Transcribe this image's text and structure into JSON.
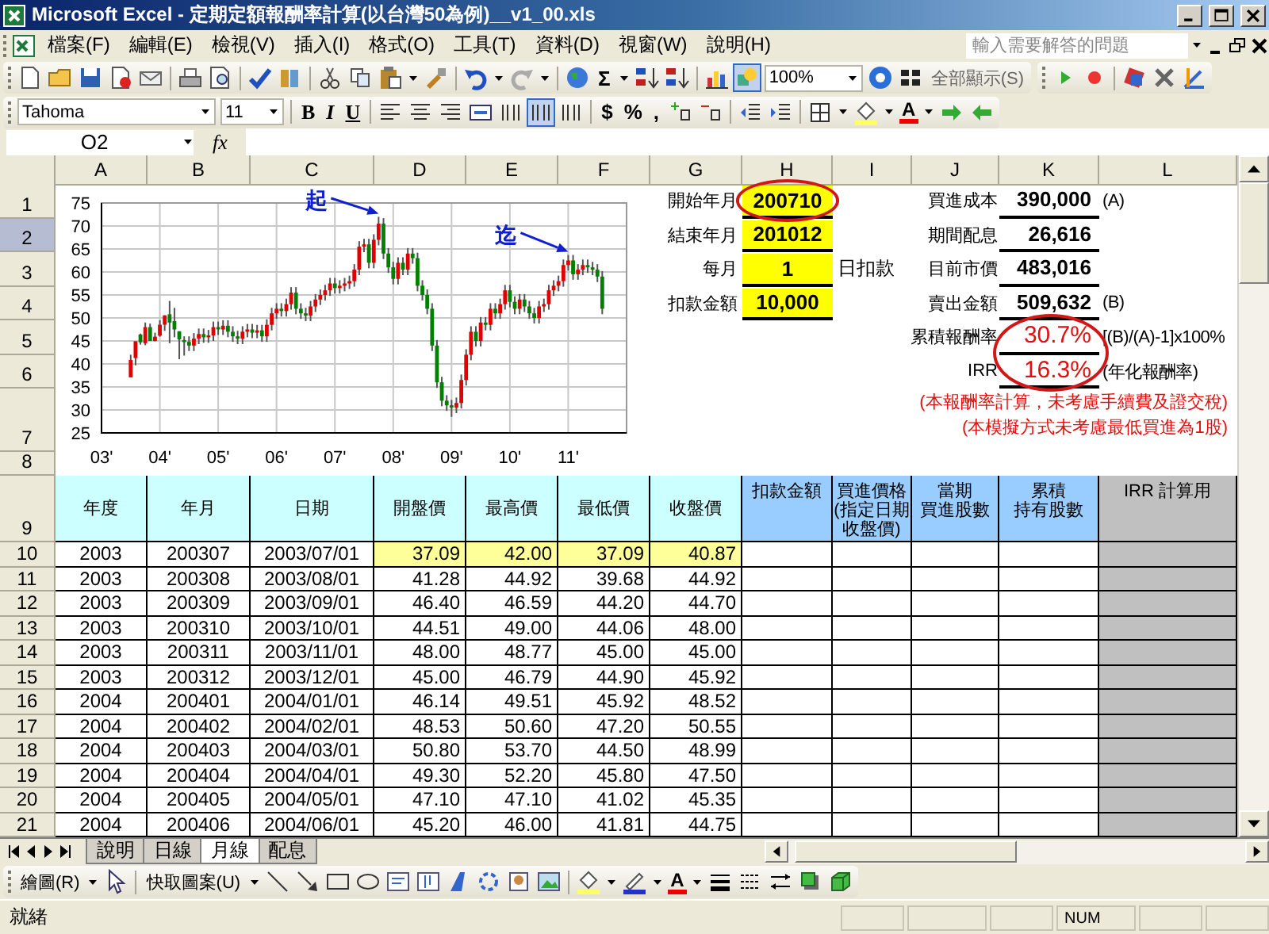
{
  "window": {
    "title": "Microsoft Excel - 定期定額報酬率計算(以台灣50為例)__v1_00.xls"
  },
  "menu": [
    "檔案(F)",
    "編輯(E)",
    "檢視(V)",
    "插入(I)",
    "格式(O)",
    "工具(T)",
    "資料(D)",
    "視窗(W)",
    "說明(H)"
  ],
  "help_box": {
    "placeholder": "輸入需要解答的問題"
  },
  "standard_toolbar": {
    "sum": "Σ",
    "drawing_button": {
      "selected": true
    },
    "zoom": "100%",
    "show_all": "全部顯示(S)"
  },
  "formatting_toolbar": {
    "font": "Tahoma",
    "size": "11",
    "styles": [
      "B",
      "I",
      "U"
    ],
    "layout_buttons": [
      {
        "selected": false
      },
      {
        "selected": true
      },
      {
        "selected": false
      }
    ],
    "currency": "$",
    "percent": "%",
    "comma": ",",
    "font_color": "A"
  },
  "formula_bar": {
    "name_box": "O2",
    "fx": "fx"
  },
  "columns": [
    "A",
    "B",
    "C",
    "D",
    "E",
    "F",
    "G",
    "H",
    "I",
    "J",
    "K",
    "L"
  ],
  "row_numbers": [
    {
      "label": "1",
      "selected": false
    },
    {
      "label": "2",
      "selected": true
    },
    {
      "label": "3",
      "selected": false
    },
    {
      "label": "4",
      "selected": false
    },
    {
      "label": "5",
      "selected": false
    },
    {
      "label": "6",
      "selected": false
    },
    {
      "label": "7",
      "selected": false
    },
    {
      "label": "8",
      "selected": false
    },
    {
      "label": "9",
      "selected": false
    },
    {
      "label": "10",
      "selected": false
    },
    {
      "label": "11",
      "selected": false
    },
    {
      "label": "12",
      "selected": false
    },
    {
      "label": "13",
      "selected": false
    },
    {
      "label": "14",
      "selected": false
    },
    {
      "label": "15",
      "selected": false
    },
    {
      "label": "16",
      "selected": false
    },
    {
      "label": "17",
      "selected": false
    },
    {
      "label": "18",
      "selected": false
    },
    {
      "label": "19",
      "selected": false
    },
    {
      "label": "20",
      "selected": false
    },
    {
      "label": "21",
      "selected": false
    }
  ],
  "chart": {
    "chart_data": {
      "type": "candlestick",
      "grid": true,
      "xlim": [
        3,
        12
      ],
      "ylim": [
        25,
        75
      ],
      "yticks": [
        25,
        30,
        35,
        40,
        45,
        50,
        55,
        60,
        65,
        70,
        75
      ],
      "xticks": [
        {
          "value": 3,
          "label": "03'"
        },
        {
          "value": 4,
          "label": "04'"
        },
        {
          "value": 5,
          "label": "05'"
        },
        {
          "value": 6,
          "label": "06'"
        },
        {
          "value": 7,
          "label": "07'"
        },
        {
          "value": 8,
          "label": "08'"
        },
        {
          "value": 9,
          "label": "09'"
        },
        {
          "value": 10,
          "label": "10'"
        },
        {
          "value": 11,
          "label": "11'"
        }
      ],
      "x": [
        3.5,
        3.583,
        3.667,
        3.75,
        3.833,
        3.917,
        4.0,
        4.083,
        4.167,
        4.25,
        4.333,
        4.417,
        4.5,
        4.583,
        4.667,
        4.75,
        4.833,
        4.917,
        5.0,
        5.083,
        5.167,
        5.25,
        5.333,
        5.417,
        5.5,
        5.583,
        5.667,
        5.75,
        5.833,
        5.917,
        6.0,
        6.083,
        6.167,
        6.25,
        6.333,
        6.417,
        6.5,
        6.583,
        6.667,
        6.75,
        6.833,
        6.917,
        7.0,
        7.083,
        7.167,
        7.25,
        7.333,
        7.417,
        7.5,
        7.583,
        7.667,
        7.75,
        7.833,
        7.917,
        8.0,
        8.083,
        8.167,
        8.25,
        8.333,
        8.417,
        8.5,
        8.583,
        8.667,
        8.75,
        8.833,
        8.917,
        9.0,
        9.083,
        9.167,
        9.25,
        9.333,
        9.417,
        9.5,
        9.583,
        9.667,
        9.75,
        9.833,
        9.917,
        10.0,
        10.083,
        10.167,
        10.25,
        10.333,
        10.417,
        10.5,
        10.583,
        10.667,
        10.75,
        10.833,
        10.917,
        11.0,
        11.083,
        11.167,
        11.25,
        11.333,
        11.417,
        11.5,
        11.583
      ],
      "ohlc": [
        [
          37.09,
          42.0,
          37.09,
          40.87
        ],
        [
          41.28,
          44.92,
          39.68,
          44.92
        ],
        [
          46.4,
          46.59,
          44.2,
          44.7
        ],
        [
          44.51,
          49.0,
          44.06,
          48.0
        ],
        [
          48.0,
          48.77,
          45.0,
          45.0
        ],
        [
          45.0,
          46.79,
          44.9,
          45.92
        ],
        [
          46.14,
          49.51,
          45.92,
          48.52
        ],
        [
          48.53,
          50.6,
          47.2,
          50.55
        ],
        [
          50.8,
          53.7,
          44.5,
          48.99
        ],
        [
          49.3,
          52.2,
          45.8,
          47.5
        ],
        [
          47.1,
          47.1,
          41.02,
          45.35
        ],
        [
          45.2,
          46.0,
          41.81,
          44.75
        ],
        [
          44.8,
          46.0,
          42.8,
          44.0
        ],
        [
          44.0,
          46.7,
          42.8,
          45.5
        ],
        [
          45.5,
          47.7,
          44.3,
          46.5
        ],
        [
          46.5,
          47.7,
          44.6,
          45.8
        ],
        [
          45.8,
          47.4,
          44.6,
          46.2
        ],
        [
          46.2,
          49.2,
          45.0,
          48.0
        ],
        [
          48.0,
          49.2,
          46.3,
          47.5
        ],
        [
          47.5,
          49.5,
          46.3,
          48.3
        ],
        [
          48.3,
          49.5,
          45.8,
          47.0
        ],
        [
          47.0,
          48.2,
          44.8,
          46.0
        ],
        [
          46.0,
          47.2,
          44.3,
          45.5
        ],
        [
          45.5,
          48.2,
          44.3,
          47.0
        ],
        [
          47.0,
          48.7,
          45.8,
          47.5
        ],
        [
          47.5,
          48.7,
          45.6,
          46.8
        ],
        [
          46.8,
          48.5,
          45.6,
          47.3
        ],
        [
          47.3,
          48.5,
          44.8,
          46.0
        ],
        [
          46.0,
          49.7,
          44.8,
          48.5
        ],
        [
          48.5,
          52.2,
          47.3,
          51.0
        ],
        [
          51.0,
          53.2,
          49.8,
          52.0
        ],
        [
          52.0,
          53.2,
          50.3,
          51.5
        ],
        [
          51.5,
          54.2,
          50.3,
          53.0
        ],
        [
          53.0,
          56.7,
          51.8,
          55.5
        ],
        [
          55.5,
          56.7,
          50.8,
          52.0
        ],
        [
          52.0,
          53.2,
          49.8,
          51.0
        ],
        [
          51.0,
          52.2,
          49.3,
          50.5
        ],
        [
          50.5,
          53.7,
          49.3,
          52.5
        ],
        [
          52.5,
          55.2,
          51.3,
          54.0
        ],
        [
          54.0,
          56.2,
          52.8,
          55.0
        ],
        [
          55.0,
          57.2,
          53.8,
          56.0
        ],
        [
          56.0,
          58.7,
          54.8,
          57.5
        ],
        [
          57.5,
          58.7,
          55.3,
          56.5
        ],
        [
          56.5,
          58.2,
          55.3,
          57.0
        ],
        [
          57.0,
          58.7,
          55.8,
          57.5
        ],
        [
          57.5,
          59.2,
          56.3,
          58.0
        ],
        [
          58.0,
          61.7,
          56.8,
          60.5
        ],
        [
          60.5,
          66.7,
          59.3,
          65.5
        ],
        [
          65.5,
          67.2,
          64.3,
          66.0
        ],
        [
          66.0,
          67.2,
          60.8,
          62.0
        ],
        [
          62.0,
          68.2,
          60.8,
          67.0
        ],
        [
          67.0,
          72.0,
          65.8,
          70.5
        ],
        [
          70.5,
          71.7,
          62.8,
          64.0
        ],
        [
          64.0,
          65.2,
          59.8,
          61.0
        ],
        [
          61.0,
          62.2,
          57.3,
          58.5
        ],
        [
          58.5,
          63.2,
          57.3,
          62.0
        ],
        [
          62.0,
          63.2,
          59.3,
          60.5
        ],
        [
          60.5,
          65.2,
          59.3,
          64.0
        ],
        [
          64.0,
          65.2,
          61.8,
          63.0
        ],
        [
          63.0,
          64.2,
          55.8,
          57.0
        ],
        [
          57.0,
          58.2,
          53.8,
          55.0
        ],
        [
          55.0,
          56.2,
          50.8,
          52.0
        ],
        [
          52.0,
          53.2,
          42.8,
          44.0
        ],
        [
          44.0,
          45.2,
          34.8,
          36.0
        ],
        [
          36.0,
          37.2,
          30.8,
          32.0
        ],
        [
          32.0,
          33.2,
          29.8,
          31.0
        ],
        [
          31.0,
          32.2,
          28.5,
          30.5
        ],
        [
          30.5,
          32.7,
          29.3,
          31.5
        ],
        [
          31.5,
          37.7,
          30.3,
          36.5
        ],
        [
          36.5,
          43.2,
          35.3,
          42.0
        ],
        [
          42.0,
          48.2,
          40.8,
          47.0
        ],
        [
          47.0,
          48.2,
          43.8,
          45.0
        ],
        [
          45.0,
          50.2,
          43.8,
          49.0
        ],
        [
          49.0,
          50.2,
          47.3,
          48.5
        ],
        [
          48.5,
          53.2,
          47.3,
          52.0
        ],
        [
          52.0,
          53.2,
          49.8,
          51.0
        ],
        [
          51.0,
          54.2,
          49.8,
          53.0
        ],
        [
          53.0,
          57.2,
          51.8,
          56.0
        ],
        [
          56.0,
          57.2,
          52.3,
          53.5
        ],
        [
          53.5,
          54.7,
          50.8,
          52.0
        ],
        [
          52.0,
          55.2,
          50.8,
          54.0
        ],
        [
          54.0,
          55.2,
          51.3,
          52.5
        ],
        [
          52.5,
          53.7,
          49.8,
          51.0
        ],
        [
          51.0,
          52.2,
          48.8,
          50.0
        ],
        [
          50.0,
          53.7,
          48.8,
          52.5
        ],
        [
          52.5,
          54.2,
          51.3,
          53.0
        ],
        [
          53.0,
          57.2,
          51.8,
          56.0
        ],
        [
          56.0,
          58.2,
          54.8,
          57.0
        ],
        [
          57.0,
          59.2,
          55.8,
          58.0
        ],
        [
          58.0,
          62.7,
          56.8,
          61.5
        ],
        [
          61.5,
          63.7,
          60.3,
          62.5
        ],
        [
          62.5,
          63.7,
          58.3,
          59.5
        ],
        [
          59.5,
          61.7,
          58.3,
          60.5
        ],
        [
          60.5,
          62.7,
          59.3,
          61.5
        ],
        [
          61.5,
          62.7,
          59.8,
          61.0
        ],
        [
          61.0,
          62.2,
          59.3,
          60.5
        ],
        [
          60.5,
          61.7,
          57.8,
          59.0
        ],
        [
          59.0,
          60.2,
          50.8,
          52.0
        ]
      ],
      "annotations": [
        {
          "text": "起",
          "x": 7.75,
          "y": 72.0
        },
        {
          "text": "迄",
          "x": 11.0,
          "y": 63.7
        }
      ]
    }
  },
  "inputs": [
    {
      "label": "開始年月",
      "value": "200710",
      "circled": true
    },
    {
      "label": "結束年月",
      "value": "201012",
      "circled": false
    },
    {
      "label": "每月",
      "value": "1",
      "suffix": "日扣款",
      "circled": false
    },
    {
      "label": "扣款金額",
      "value": "10,000",
      "circled": false
    }
  ],
  "results": [
    {
      "label": "買進成本",
      "value": "390,000",
      "note": "(A)",
      "circled": false
    },
    {
      "label": "期間配息",
      "value": "26,616",
      "circled": false
    },
    {
      "label": "目前市價",
      "value": "483,016",
      "circled": false
    },
    {
      "label": "賣出金額",
      "value": "509,632",
      "note": "(B)",
      "circled": false
    },
    {
      "label": "累積報酬率",
      "value": "30.7%",
      "note": "[(B)/(A)-1]x100%",
      "circled": true
    },
    {
      "label": "IRR",
      "value": "16.3%",
      "note": "(年化報酬率)",
      "circled": true
    }
  ],
  "remarks": [
    "(本報酬率計算，未考慮手續費及證交稅)",
    "(本模擬方式未考慮最低買進為1股)"
  ],
  "table": {
    "headers": [
      {
        "lines": [
          "年度"
        ],
        "kind": "data"
      },
      {
        "lines": [
          "年月"
        ],
        "kind": "data"
      },
      {
        "lines": [
          "日期"
        ],
        "kind": "data"
      },
      {
        "lines": [
          "開盤價"
        ],
        "kind": "data"
      },
      {
        "lines": [
          "最高價"
        ],
        "kind": "data"
      },
      {
        "lines": [
          "最低價"
        ],
        "kind": "data"
      },
      {
        "lines": [
          "收盤價"
        ],
        "kind": "data"
      },
      {
        "lines": [
          "扣款金額"
        ],
        "kind": "calc"
      },
      {
        "lines": [
          "買進價格",
          "(指定日期",
          "收盤價)"
        ],
        "kind": "calc"
      },
      {
        "lines": [
          "當期",
          "買進股數"
        ],
        "kind": "calc"
      },
      {
        "lines": [
          "累積",
          "持有股數"
        ],
        "kind": "calc"
      },
      {
        "lines": [
          "IRR 計算用"
        ],
        "kind": "irr"
      }
    ],
    "rows": [
      {
        "cells": [
          "2003",
          "200307",
          "2003/07/01",
          "37.09",
          "42.00",
          "37.09",
          "40.87"
        ],
        "highlight": true
      },
      {
        "cells": [
          "2003",
          "200308",
          "2003/08/01",
          "41.28",
          "44.92",
          "39.68",
          "44.92"
        ],
        "highlight": false
      },
      {
        "cells": [
          "2003",
          "200309",
          "2003/09/01",
          "46.40",
          "46.59",
          "44.20",
          "44.70"
        ],
        "highlight": false
      },
      {
        "cells": [
          "2003",
          "200310",
          "2003/10/01",
          "44.51",
          "49.00",
          "44.06",
          "48.00"
        ],
        "highlight": false
      },
      {
        "cells": [
          "2003",
          "200311",
          "2003/11/01",
          "48.00",
          "48.77",
          "45.00",
          "45.00"
        ],
        "highlight": false
      },
      {
        "cells": [
          "2003",
          "200312",
          "2003/12/01",
          "45.00",
          "46.79",
          "44.90",
          "45.92"
        ],
        "highlight": false
      },
      {
        "cells": [
          "2004",
          "200401",
          "2004/01/01",
          "46.14",
          "49.51",
          "45.92",
          "48.52"
        ],
        "highlight": false
      },
      {
        "cells": [
          "2004",
          "200402",
          "2004/02/01",
          "48.53",
          "50.60",
          "47.20",
          "50.55"
        ],
        "highlight": false
      },
      {
        "cells": [
          "2004",
          "200403",
          "2004/03/01",
          "50.80",
          "53.70",
          "44.50",
          "48.99"
        ],
        "highlight": false
      },
      {
        "cells": [
          "2004",
          "200404",
          "2004/04/01",
          "49.30",
          "52.20",
          "45.80",
          "47.50"
        ],
        "highlight": false
      },
      {
        "cells": [
          "2004",
          "200405",
          "2004/05/01",
          "47.10",
          "47.10",
          "41.02",
          "45.35"
        ],
        "highlight": false
      },
      {
        "cells": [
          "2004",
          "200406",
          "2004/06/01",
          "45.20",
          "46.00",
          "41.81",
          "44.75"
        ],
        "highlight": false
      }
    ]
  },
  "sheet_tabs": [
    {
      "label": "說明",
      "selected": false
    },
    {
      "label": "日線",
      "selected": false
    },
    {
      "label": "月線",
      "selected": true
    },
    {
      "label": "配息",
      "selected": false
    }
  ],
  "drawing_toolbar": {
    "draw": "繪圖(R)",
    "autoshapes": "快取圖案(U)",
    "font_color": "A"
  },
  "status_bar": {
    "text": "就緒",
    "num": "NUM"
  }
}
